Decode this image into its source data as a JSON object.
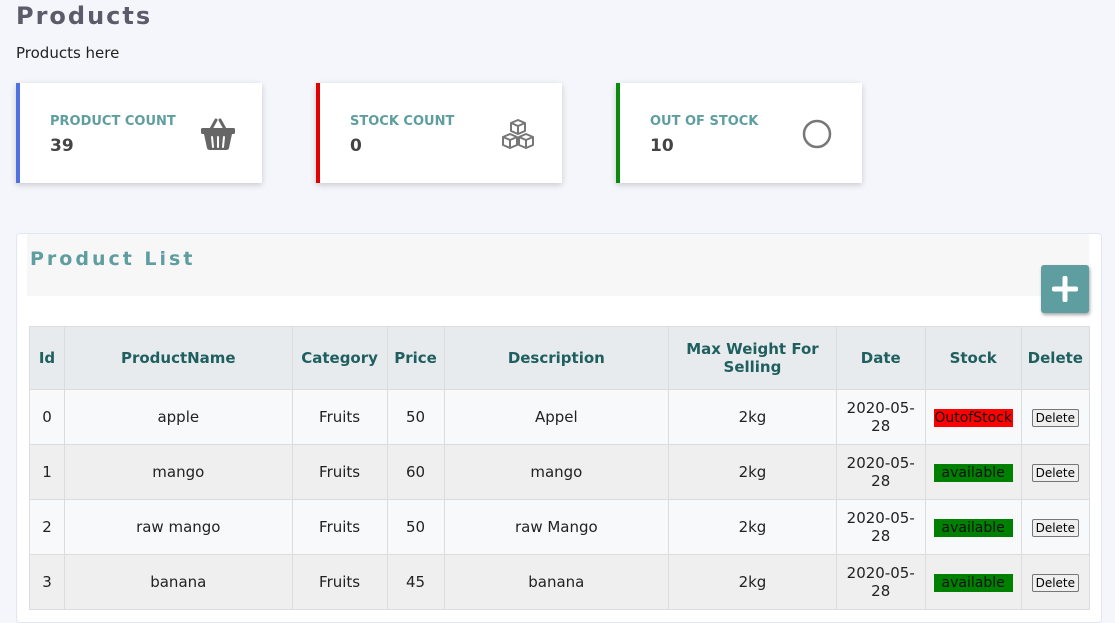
{
  "page": {
    "title": "Products",
    "subtitle": "Products here"
  },
  "cards": [
    {
      "label": "PRODUCT COUNT",
      "value": "39",
      "icon": "basket-icon",
      "accent": "#4e73df"
    },
    {
      "label": "STOCK COUNT",
      "value": "0",
      "icon": "cubes-icon",
      "accent": "#e00000"
    },
    {
      "label": "OUT OF STOCK",
      "value": "10",
      "icon": "circle-icon",
      "accent": "#0a8a0a"
    }
  ],
  "product_list": {
    "title": "Product List",
    "add_icon": "plus-icon",
    "columns": [
      "Id",
      "ProductName",
      "Category",
      "Price",
      "Description",
      "Max Weight For Selling",
      "Date",
      "Stock",
      "Delete"
    ],
    "rows": [
      {
        "id": "0",
        "name": "apple",
        "category": "Fruits",
        "price": "50",
        "description": "Appel",
        "max_weight": "2kg",
        "date": "2020-05-28",
        "stock": "OutofStock",
        "stock_color": "#ff0000",
        "delete_label": "Delete"
      },
      {
        "id": "1",
        "name": "mango",
        "category": "Fruits",
        "price": "60",
        "description": "mango",
        "max_weight": "2kg",
        "date": "2020-05-28",
        "stock": "available",
        "stock_color": "#008000",
        "delete_label": "Delete"
      },
      {
        "id": "2",
        "name": "raw mango",
        "category": "Fruits",
        "price": "50",
        "description": "raw Mango",
        "max_weight": "2kg",
        "date": "2020-05-28",
        "stock": "available",
        "stock_color": "#008000",
        "delete_label": "Delete"
      },
      {
        "id": "3",
        "name": "banana",
        "category": "Fruits",
        "price": "45",
        "description": "banana",
        "max_weight": "2kg",
        "date": "2020-05-28",
        "stock": "available",
        "stock_color": "#008000",
        "delete_label": "Delete"
      }
    ]
  }
}
